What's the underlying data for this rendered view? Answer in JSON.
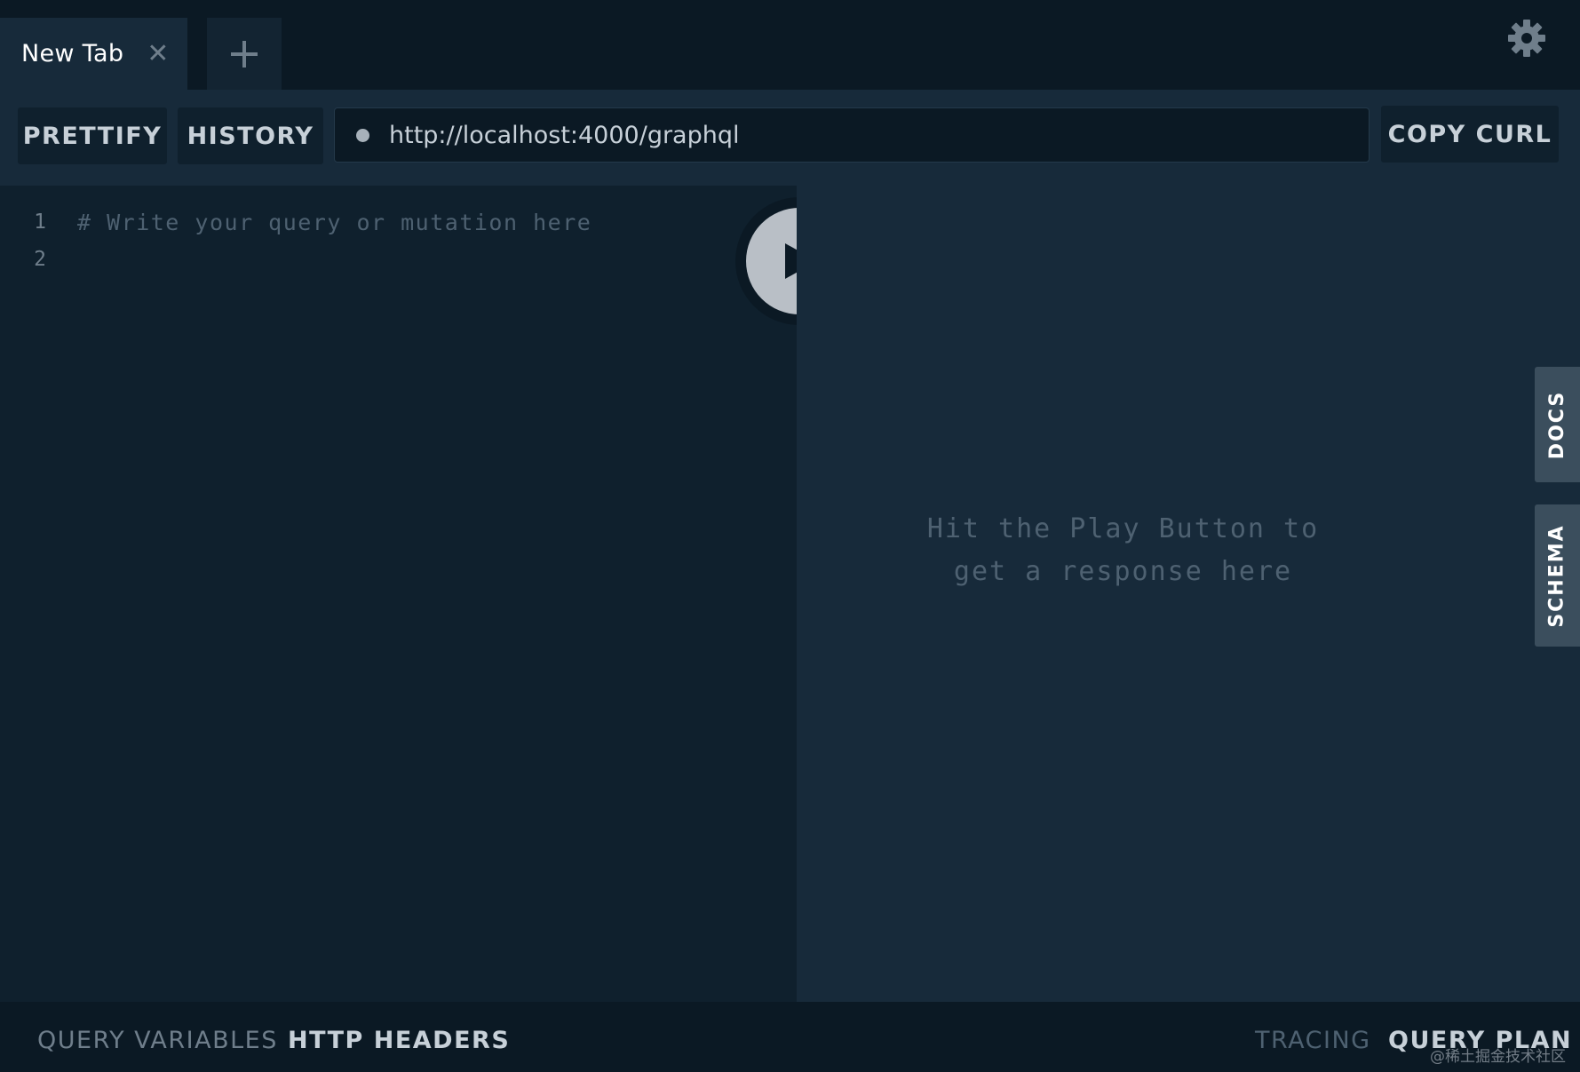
{
  "tabs": [
    {
      "title": "New Tab",
      "close_icon": "close-icon"
    }
  ],
  "new_tab_icon": "plus-icon",
  "settings_icon": "gear-icon",
  "toolbar": {
    "prettify_label": "PRETTIFY",
    "history_label": "HISTORY",
    "endpoint_url": "http://localhost:4000/graphql",
    "copy_curl_label": "COPY CURL"
  },
  "editor": {
    "lines": [
      {
        "number": "1",
        "text": "# Write your query or mutation here"
      },
      {
        "number": "2",
        "text": ""
      }
    ]
  },
  "play_icon": "play-icon",
  "result": {
    "hint": "Hit the Play Button to\nget a response here"
  },
  "side_tabs": {
    "docs": "DOCS",
    "schema": "SCHEMA"
  },
  "bottom": {
    "query_variables": "QUERY VARIABLES",
    "http_headers": "HTTP HEADERS",
    "tracing": "TRACING",
    "query_plan": "QUERY PLAN"
  },
  "watermark": "@稀土掘金技术社区",
  "colors": {
    "background": "#0f202d",
    "toolbar": "#172a3a",
    "dark": "#0b1924",
    "text": "#c7d0d8",
    "muted": "#6f7e8b",
    "side_tab": "#3b4e5d"
  }
}
